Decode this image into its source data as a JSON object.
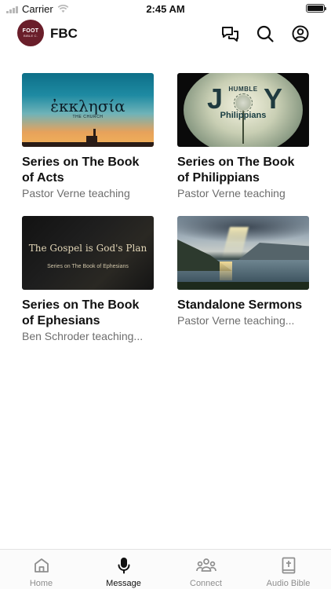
{
  "status_bar": {
    "carrier": "Carrier",
    "time": "2:45 AM",
    "battery_level": 1.0
  },
  "header": {
    "logo_text_line1": "FOOT",
    "logo_text_line2": "BIBLE C.",
    "title": "FBC",
    "icons": [
      "chat-icon",
      "search-icon",
      "profile-icon"
    ]
  },
  "series": [
    {
      "title": "Series on The Book of Acts",
      "subtitle": "Pastor Verne teaching",
      "art": {
        "headline": "ἐκκλησία",
        "caption": "THE CHURCH"
      }
    },
    {
      "title": "Series on The Book of Philippians",
      "subtitle": "Pastor Verne teaching",
      "art": {
        "left": "J",
        "right": "Y",
        "caption_top": "HUMBLE",
        "caption_bottom": "Philippians"
      }
    },
    {
      "title": "Series on The Book of Ephesians",
      "subtitle": "Ben Schroder teaching...",
      "art": {
        "headline": "The Gospel is God's Plan",
        "caption": "Series on The Book of Ephesians"
      }
    },
    {
      "title": "Standalone Sermons",
      "subtitle": "Pastor Verne teaching..."
    }
  ],
  "tabs": [
    {
      "label": "Home",
      "icon": "home-icon",
      "active": false
    },
    {
      "label": "Message",
      "icon": "microphone-icon",
      "active": true
    },
    {
      "label": "Connect",
      "icon": "people-icon",
      "active": false
    },
    {
      "label": "Audio Bible",
      "icon": "bible-icon",
      "active": false
    }
  ],
  "colors": {
    "logo_bg": "#6a1e2a",
    "tab_active": "#111111",
    "tab_inactive": "#8e8e8e",
    "subtitle": "#6d6d6d"
  }
}
